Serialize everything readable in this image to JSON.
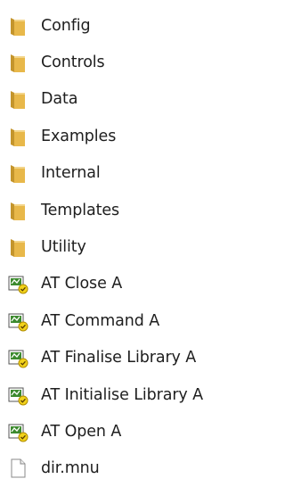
{
  "items": [
    {
      "label": "Config",
      "icon": "folder-icon"
    },
    {
      "label": "Controls",
      "icon": "folder-icon"
    },
    {
      "label": "Data",
      "icon": "folder-icon"
    },
    {
      "label": "Examples",
      "icon": "folder-icon"
    },
    {
      "label": "Internal",
      "icon": "folder-icon"
    },
    {
      "label": "Templates",
      "icon": "folder-icon"
    },
    {
      "label": "Utility",
      "icon": "folder-icon"
    },
    {
      "label": "AT Close A",
      "icon": "labview-vi-icon"
    },
    {
      "label": "AT Command A",
      "icon": "labview-vi-icon"
    },
    {
      "label": "AT Finalise Library A",
      "icon": "labview-vi-icon"
    },
    {
      "label": "AT Initialise Library A",
      "icon": "labview-vi-icon"
    },
    {
      "label": "AT Open A",
      "icon": "labview-vi-icon"
    },
    {
      "label": "dir.mnu",
      "icon": "file-icon"
    }
  ],
  "colors": {
    "text": "#1e1e1e",
    "folder": "#e8b84a",
    "folder_dark": "#c4952c",
    "vi_green": "#3c8a2e",
    "vi_yellow": "#f2d21a"
  }
}
